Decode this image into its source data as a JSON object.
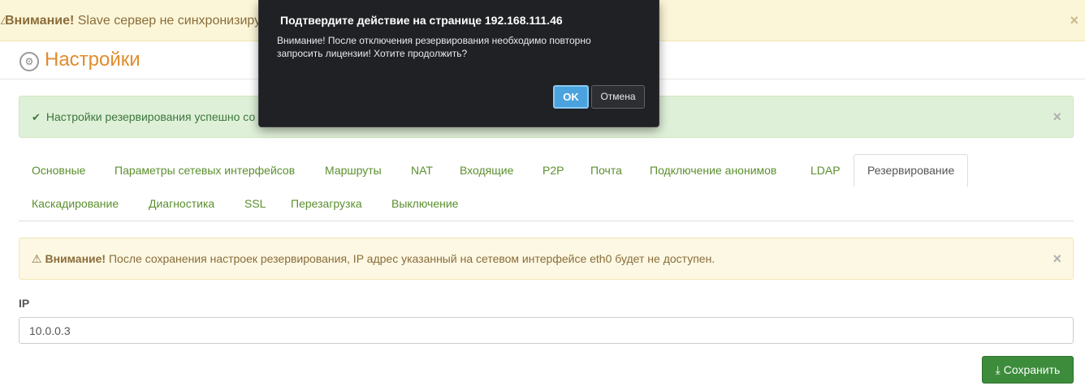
{
  "top_warning": {
    "bold": "Внимание!",
    "text": " Slave сервер не синхронизиру",
    "close": "×"
  },
  "header": {
    "icon": "gears-icon",
    "title": "Настройки"
  },
  "success_alert": {
    "icon": "check-icon",
    "text": "Настройки резервирования успешно со",
    "close": "×"
  },
  "tabs": {
    "row1": [
      {
        "label": "Основные"
      },
      {
        "label": "Параметры сетевых интерфейсов"
      },
      {
        "label": "Маршруты"
      },
      {
        "label": "NAT"
      },
      {
        "label": "Входящие"
      },
      {
        "label": "P2P"
      },
      {
        "label": "Почта"
      },
      {
        "label": "Подключение анонимов"
      },
      {
        "label": "LDAP"
      },
      {
        "label": "Резервирование",
        "active": true
      }
    ],
    "row2": [
      {
        "label": "Каскадирование"
      },
      {
        "label": "Диагностика"
      },
      {
        "label": "SSL"
      },
      {
        "label": "Перезагрузка"
      },
      {
        "label": "Выключение"
      }
    ]
  },
  "warning_alert": {
    "icon": "warning-icon",
    "bold": "Внимание!",
    "text": " После сохранения настроек резервирования, IP адрес указанный на сетевом интерфейсе eth0 будет не доступен.",
    "close": "×"
  },
  "ip_field": {
    "label": "IP",
    "value": "10.0.0.3"
  },
  "save_button": {
    "icon": "download-icon",
    "label": "Сохранить"
  },
  "dialog": {
    "title": "Подтвердите действие на странице 192.168.111.46",
    "message": "Внимание! После отключения резервирования необходимо повторно запросить лицензии! Хотите продолжить?",
    "ok_label": "OK",
    "cancel_label": "Отмена"
  },
  "colors": {
    "accent_orange": "#e08d2c",
    "tab_green": "#5b8f2e",
    "save_green": "#3c8c3c",
    "ok_blue": "#4aa3df"
  }
}
